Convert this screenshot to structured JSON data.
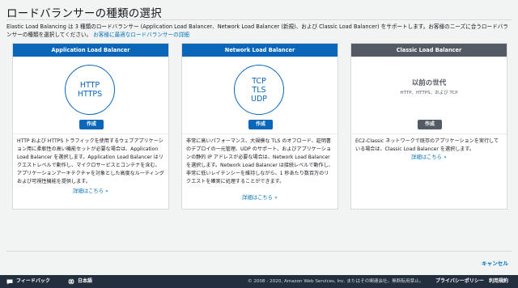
{
  "header": {
    "title": "ロードバランサーの種類の選択",
    "intro_text": "Elastic Load Balancing は 3 種類のロードバランサー (Application Load Balancer、Network Load Balancer (新規)、および Classic Load Balancer) をサポートします。お客様のニーズに合うロードバランサーの種類を選択してください。",
    "intro_link": "お客様に最適なロードバランサーの詳細"
  },
  "cards": [
    {
      "heading": "Application Load Balancer",
      "lines": [
        "HTTP",
        "HTTPS"
      ],
      "create_label": "作成",
      "description": "HTTP および HTTPS トラフィックを使用するウェブアプリケーション用に柔軟性の高い機能セットが必要な場合は、Application Load Balancer を選択します。Application Load Balancer はリクエストレベルで動作し、マイクロサービスとコンテナを含む、アプリケーションアーキテクチャを対象とした高度なルーティングおよび可視性機能を提供します。",
      "more_label": "詳細はこちら »"
    },
    {
      "heading": "Network Load Balancer",
      "lines": [
        "TCP",
        "TLS",
        "UDP"
      ],
      "create_label": "作成",
      "description": "非常に高いパフォーマンス、大規模な TLS のオフロード、証明書のデプロイの一元管理、UDP のサポート、およびアプリケーションの静的 IP アドレスが必要な場合は、Network Load Balancer を選択します。Network Load Balancer は接続レベルで動作し、非常に低いレイテンシーを維持しながら、1 秒あたり数百万のリクエストを確実に処理することができます。",
      "more_label": "詳細はこちら »"
    },
    {
      "heading": "Classic Load Balancer",
      "legacy_title": "以前の世代",
      "legacy_sub": "HTTP、HTTPS、および TCP",
      "create_label": "作成",
      "description": "EC2-Classic ネットワークで既存のアプリケーションを実行している場合は、Classic Load Balancer を選択します。",
      "more_label": "詳細はこちら »"
    }
  ],
  "actions": {
    "cancel_label": "キャンセル"
  },
  "footer": {
    "feedback_label": "フィードバック",
    "language_label": "日本語",
    "copyright": "© 2008 - 2020, Amazon Web Services, Inc. またはその関連会社。無断転用禁止。",
    "privacy_label": "プライバシーポリシー",
    "terms_label": "利用規約"
  },
  "colors": {
    "accent_blue": "#0a66b8",
    "link_blue": "#0073bb",
    "legacy_gray": "#545b64",
    "footer_bg": "#232f3e"
  }
}
